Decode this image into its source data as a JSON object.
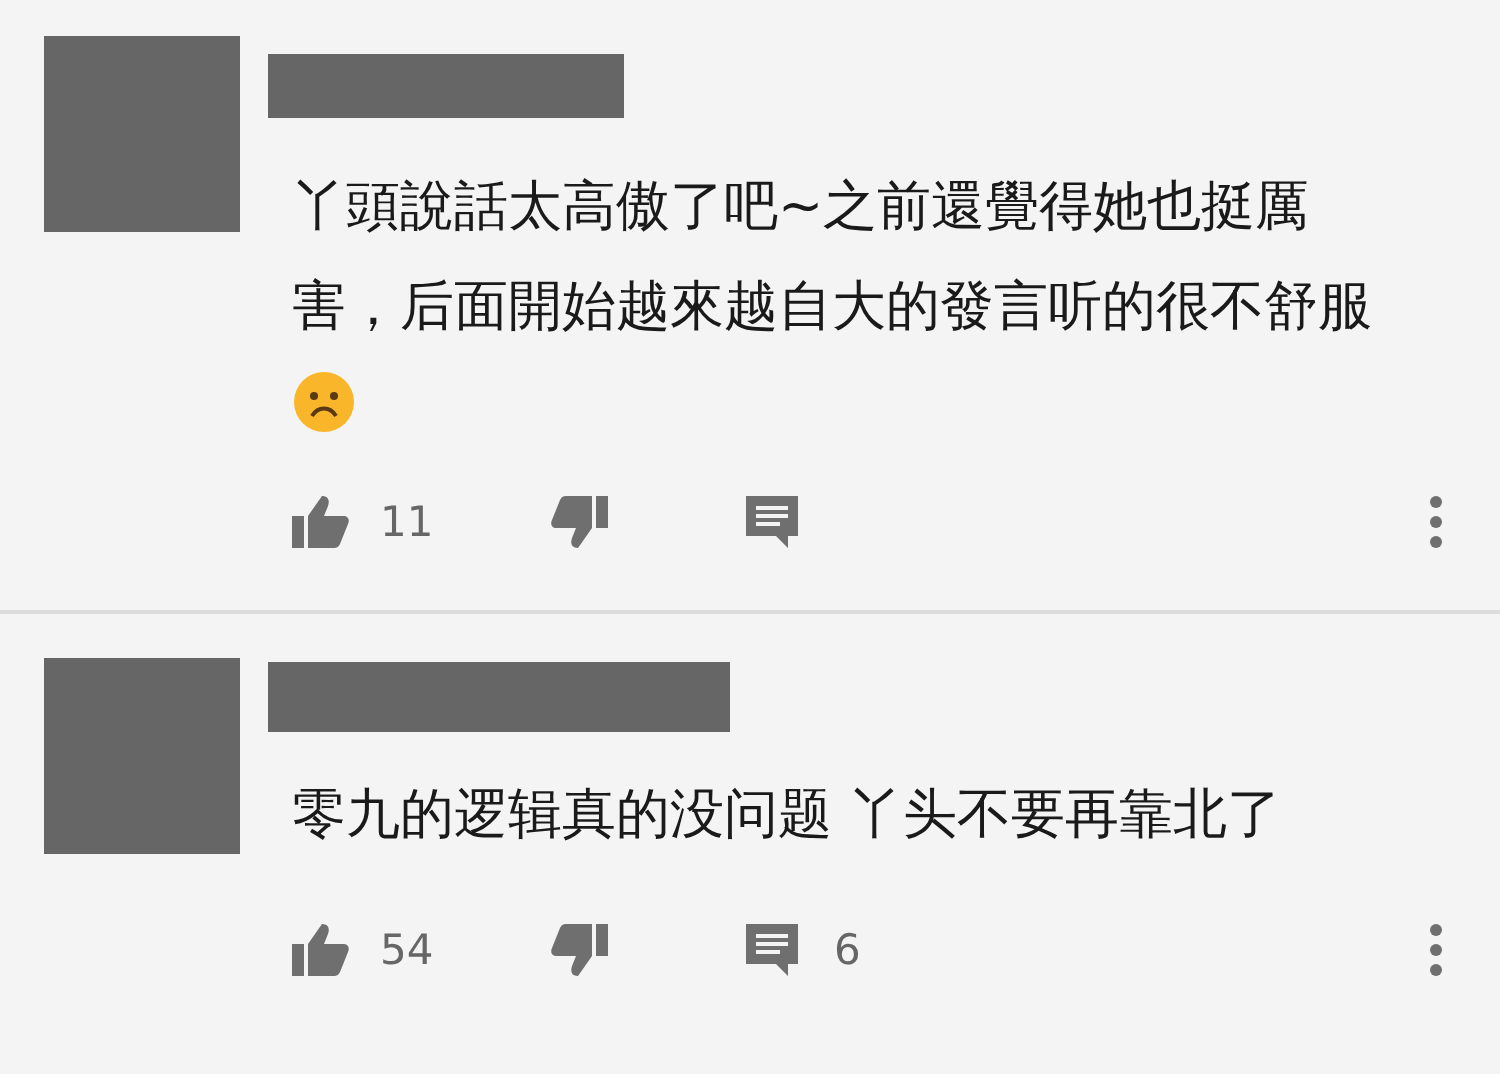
{
  "comments": [
    {
      "text": "丫頭說話太高傲了吧~之前還覺得她也挺厲害，后面開始越來越自大的發言听的很不舒服",
      "frown_emoji": true,
      "like_count": "11"
    },
    {
      "text": "零九的逻辑真的没问题 丫头不要再靠北了",
      "frown_emoji": false,
      "like_count": "54",
      "reply_count": "6"
    }
  ]
}
